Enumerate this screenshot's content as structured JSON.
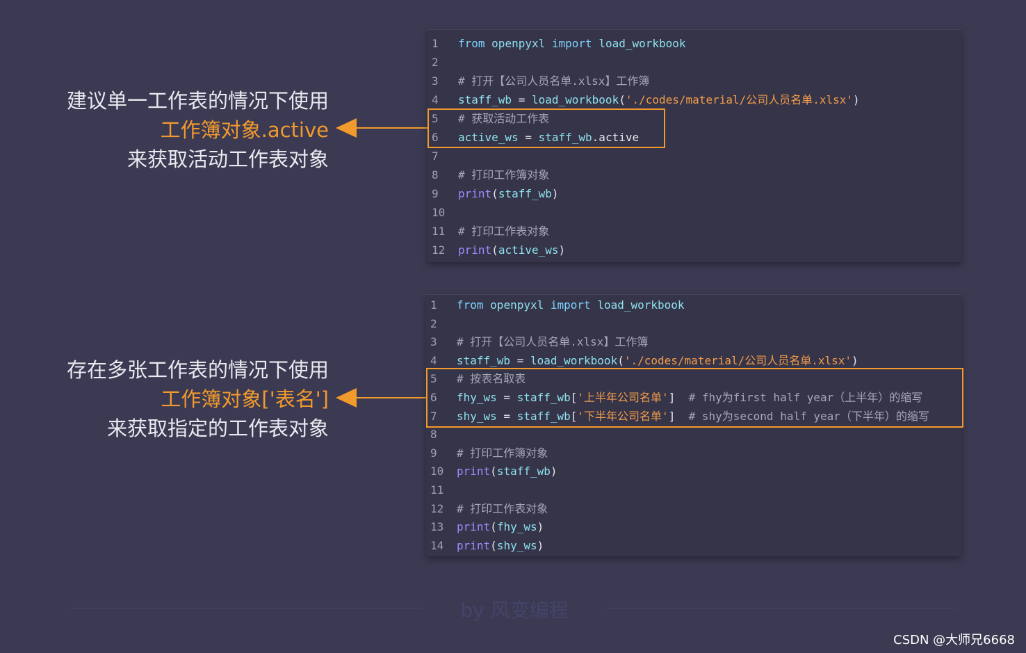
{
  "annotation1": {
    "line1": "建议单一工作表的情况下使用",
    "line2": "工作簿对象.active",
    "line3": "来获取活动工作表对象"
  },
  "annotation2": {
    "line1": "存在多张工作表的情况下使用",
    "line2": "工作簿对象['表名']",
    "line3": "来获取指定的工作表对象"
  },
  "code1": [
    {
      "n": "1",
      "tokens": [
        [
          "kw",
          "from"
        ],
        [
          "op",
          " "
        ],
        [
          "id",
          "openpyxl"
        ],
        [
          "op",
          " "
        ],
        [
          "kw",
          "import"
        ],
        [
          "op",
          " "
        ],
        [
          "id",
          "load_workbook"
        ]
      ]
    },
    {
      "n": "2",
      "tokens": []
    },
    {
      "n": "3",
      "tokens": [
        [
          "cmt",
          "# 打开【公司人员名单.xlsx】工作簿"
        ]
      ]
    },
    {
      "n": "4",
      "tokens": [
        [
          "id",
          "staff_wb"
        ],
        [
          "op",
          " = "
        ],
        [
          "id",
          "load_workbook"
        ],
        [
          "op",
          "("
        ],
        [
          "str",
          "'./codes/material/公司人员名单.xlsx'"
        ],
        [
          "op",
          ")"
        ]
      ]
    },
    {
      "n": "5",
      "tokens": [
        [
          "cmt",
          "# 获取活动工作表"
        ]
      ]
    },
    {
      "n": "6",
      "tokens": [
        [
          "id",
          "active_ws"
        ],
        [
          "op",
          " = "
        ],
        [
          "id",
          "staff_wb"
        ],
        [
          "op",
          ".active"
        ]
      ]
    },
    {
      "n": "7",
      "tokens": []
    },
    {
      "n": "8",
      "tokens": [
        [
          "cmt",
          "# 打印工作簿对象"
        ]
      ]
    },
    {
      "n": "9",
      "tokens": [
        [
          "fn",
          "print"
        ],
        [
          "op",
          "("
        ],
        [
          "id",
          "staff_wb"
        ],
        [
          "op",
          ")"
        ]
      ]
    },
    {
      "n": "10",
      "tokens": []
    },
    {
      "n": "11",
      "tokens": [
        [
          "cmt",
          "# 打印工作表对象"
        ]
      ]
    },
    {
      "n": "12",
      "tokens": [
        [
          "fn",
          "print"
        ],
        [
          "op",
          "("
        ],
        [
          "id",
          "active_ws"
        ],
        [
          "op",
          ")"
        ]
      ]
    }
  ],
  "code2": [
    {
      "n": "1",
      "tokens": [
        [
          "kw",
          "from"
        ],
        [
          "op",
          " "
        ],
        [
          "id",
          "openpyxl"
        ],
        [
          "op",
          " "
        ],
        [
          "kw",
          "import"
        ],
        [
          "op",
          " "
        ],
        [
          "id",
          "load_workbook"
        ]
      ]
    },
    {
      "n": "2",
      "tokens": []
    },
    {
      "n": "3",
      "tokens": [
        [
          "cmt",
          "# 打开【公司人员名单.xlsx】工作簿"
        ]
      ]
    },
    {
      "n": "4",
      "tokens": [
        [
          "id",
          "staff_wb"
        ],
        [
          "op",
          " = "
        ],
        [
          "id",
          "load_workbook"
        ],
        [
          "op",
          "("
        ],
        [
          "str",
          "'./codes/material/公司人员名单.xlsx'"
        ],
        [
          "op",
          ")"
        ]
      ]
    },
    {
      "n": "5",
      "tokens": [
        [
          "cmt",
          "# 按表名取表"
        ]
      ]
    },
    {
      "n": "6",
      "tokens": [
        [
          "id",
          "fhy_ws"
        ],
        [
          "op",
          " = "
        ],
        [
          "id",
          "staff_wb"
        ],
        [
          "op",
          "["
        ],
        [
          "str",
          "'上半年公司名单'"
        ],
        [
          "op",
          "]  "
        ],
        [
          "cmt",
          "# fhy为first half year（上半年）的缩写"
        ]
      ]
    },
    {
      "n": "7",
      "tokens": [
        [
          "id",
          "shy_ws"
        ],
        [
          "op",
          " = "
        ],
        [
          "id",
          "staff_wb"
        ],
        [
          "op",
          "["
        ],
        [
          "str",
          "'下半年公司名单'"
        ],
        [
          "op",
          "]  "
        ],
        [
          "cmt",
          "# shy为second half year（下半年）的缩写"
        ]
      ]
    },
    {
      "n": "8",
      "tokens": []
    },
    {
      "n": "9",
      "tokens": [
        [
          "cmt",
          "# 打印工作簿对象"
        ]
      ]
    },
    {
      "n": "10",
      "tokens": [
        [
          "fn",
          "print"
        ],
        [
          "op",
          "("
        ],
        [
          "id",
          "staff_wb"
        ],
        [
          "op",
          ")"
        ]
      ]
    },
    {
      "n": "11",
      "tokens": []
    },
    {
      "n": "12",
      "tokens": [
        [
          "cmt",
          "# 打印工作表对象"
        ]
      ]
    },
    {
      "n": "13",
      "tokens": [
        [
          "fn",
          "print"
        ],
        [
          "op",
          "("
        ],
        [
          "id",
          "fhy_ws"
        ],
        [
          "op",
          ")"
        ]
      ]
    },
    {
      "n": "14",
      "tokens": [
        [
          "fn",
          "print"
        ],
        [
          "op",
          "("
        ],
        [
          "id",
          "shy_ws"
        ],
        [
          "op",
          ")"
        ]
      ]
    }
  ],
  "footer": {
    "signature": "by 风变编程",
    "watermark": "CSDN @大师兄6668"
  },
  "colors": {
    "background": "#3b3a52",
    "panel": "#353448",
    "accent_orange": "#f39a2d",
    "keyword": "#7fd3ff",
    "function": "#9d8cff",
    "identifier": "#8fe1ee",
    "string": "#f39c4a",
    "comment": "#a6a7b8"
  }
}
